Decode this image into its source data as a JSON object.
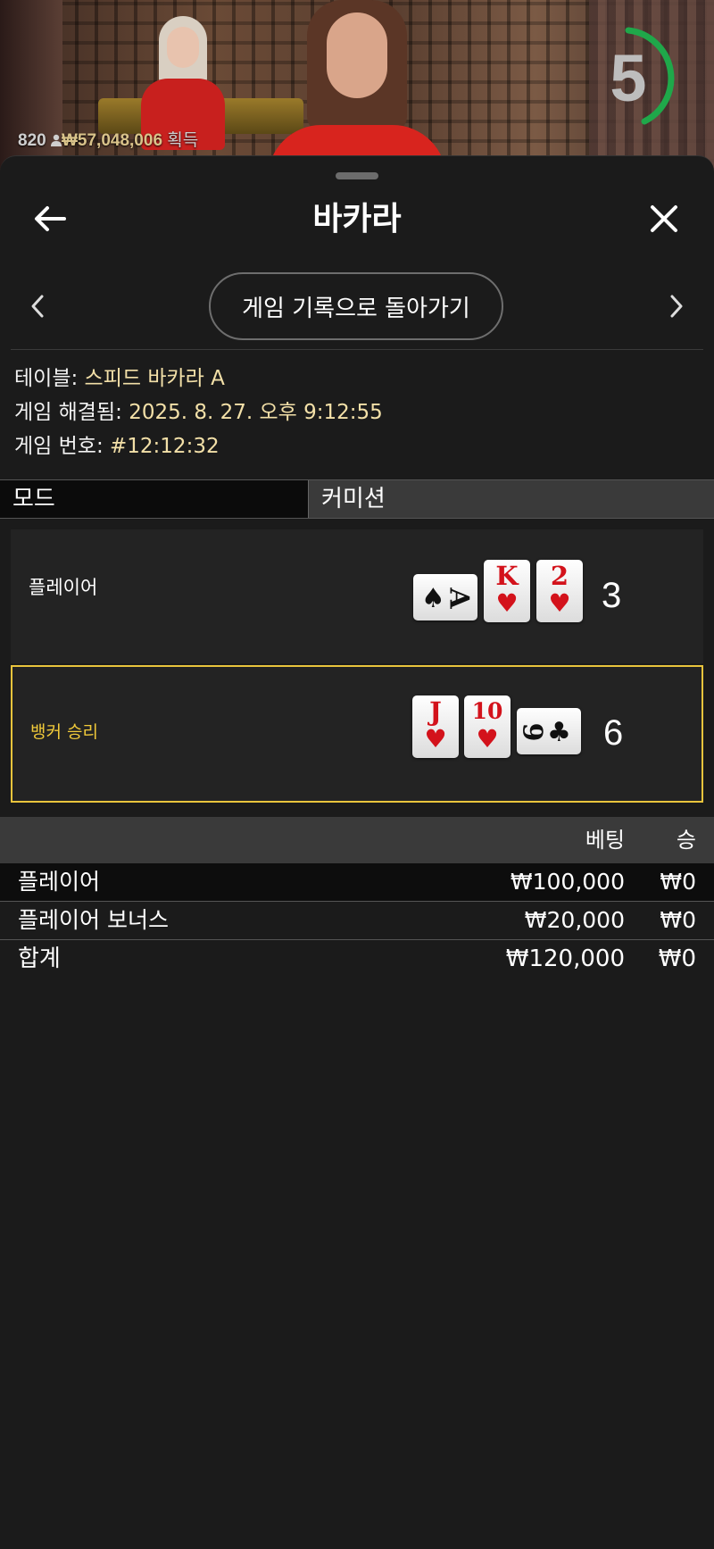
{
  "video": {
    "player_count": "820",
    "winnings": "₩57,048,006",
    "winnings_label": "획득",
    "countdown": "5"
  },
  "header": {
    "title": "바카라"
  },
  "nav": {
    "back_to_history": "게임 기록으로 돌아가기"
  },
  "game_info": {
    "table_label": "테이블:",
    "table_value": "스피드 바카라 A",
    "resolved_label": "게임 해결됨:",
    "resolved_value": "2025. 8. 27. 오후 9:12:55",
    "number_label": "게임 번호:",
    "number_value": "#12:12:32"
  },
  "mode": {
    "label": "모드",
    "value": "커미션"
  },
  "hands": {
    "player": {
      "label": "플레이어",
      "total": "3",
      "cards": [
        {
          "rank": "A",
          "suit": "♠",
          "color": "black",
          "orientation": "horizontal"
        },
        {
          "rank": "K",
          "suit": "♥",
          "color": "red",
          "orientation": "vertical"
        },
        {
          "rank": "2",
          "suit": "♥",
          "color": "red",
          "orientation": "vertical"
        }
      ]
    },
    "banker": {
      "label": "뱅커 승리",
      "total": "6",
      "cards": [
        {
          "rank": "J",
          "suit": "♥",
          "color": "red",
          "orientation": "vertical"
        },
        {
          "rank": "10",
          "suit": "♥",
          "color": "red",
          "orientation": "vertical"
        },
        {
          "rank": "9",
          "suit": "♣",
          "color": "black",
          "orientation": "horizontal"
        }
      ]
    }
  },
  "bets": {
    "headers": {
      "bet": "베팅",
      "win": "승"
    },
    "rows": [
      {
        "name": "플레이어",
        "bet": "₩100,000",
        "win": "₩0"
      },
      {
        "name": "플레이어 보너스",
        "bet": "₩20,000",
        "win": "₩0"
      }
    ],
    "total": {
      "name": "합계",
      "bet": "₩120,000",
      "win": "₩0"
    }
  },
  "colors": {
    "background": "#1b1b1b",
    "accent_gold": "#e9c43c",
    "info_value": "#f3e0a8",
    "countdown_ring": "#1fa84a",
    "card_red": "#d3121b"
  },
  "icons": {
    "back": "arrow-left-icon",
    "close": "close-icon",
    "prev": "chevron-left-icon",
    "next": "chevron-right-icon"
  }
}
